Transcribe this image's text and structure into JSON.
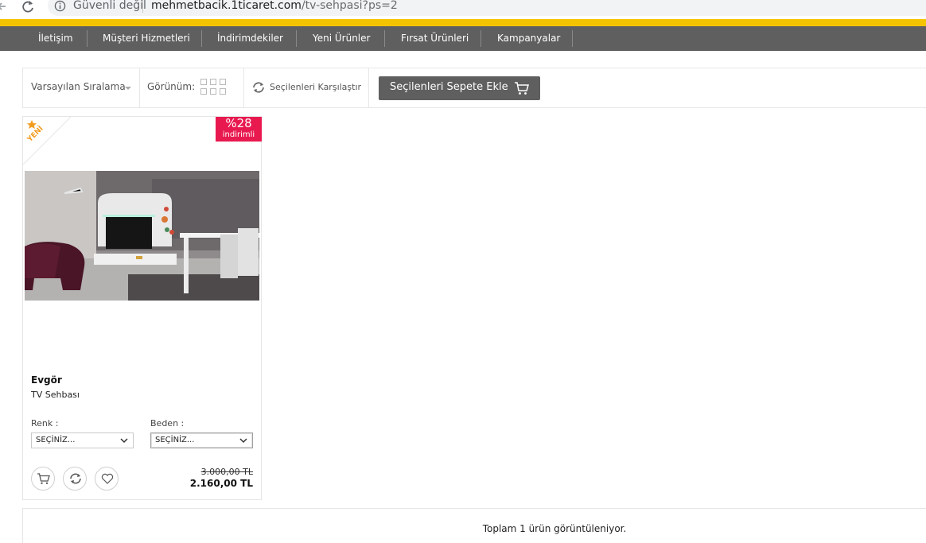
{
  "browser": {
    "security_label": "Güvenli değil",
    "url_host": "mehmetbacik.1ticaret.com",
    "url_path": "/tv-sehpasi?ps=2"
  },
  "menu": {
    "items": [
      "İletişim",
      "Müşteri Hizmetleri",
      "İndirimdekiler",
      "Yeni Ürünler",
      "Fırsat Ürünleri",
      "Kampanyalar"
    ]
  },
  "toolbar": {
    "sort_label": "Varsayılan Sıralama",
    "view_label": "Görünüm:",
    "compare_label": "Seçilenleri Karşılaştır",
    "add_to_cart_label": "Seçilenleri Sepete Ekle"
  },
  "product": {
    "ribbon": "YENİ",
    "discount_value": "%28",
    "discount_label": "indirimli",
    "brand": "Evgör",
    "name": "TV Sehbası",
    "color_label": "Renk :",
    "color_value": "SEÇİNİZ...",
    "size_label": "Beden :",
    "size_value": "SEÇİNİZ...",
    "old_price": "3.000,00 TL",
    "new_price": "2.160,00 TL"
  },
  "summary": {
    "text": "Toplam 1 ürün görüntüleniyor."
  },
  "colors": {
    "accent_yellow": "#f5c400",
    "menu_gray": "#5f5f5f",
    "discount_red": "#e8194f",
    "ribbon_orange": "#f29c1f"
  },
  "icons": [
    "back-arrow-icon",
    "reload-icon",
    "info-icon",
    "grid-view-icon",
    "compare-icon",
    "cart-icon",
    "heart-icon",
    "chevron-down-icon",
    "star-icon"
  ]
}
